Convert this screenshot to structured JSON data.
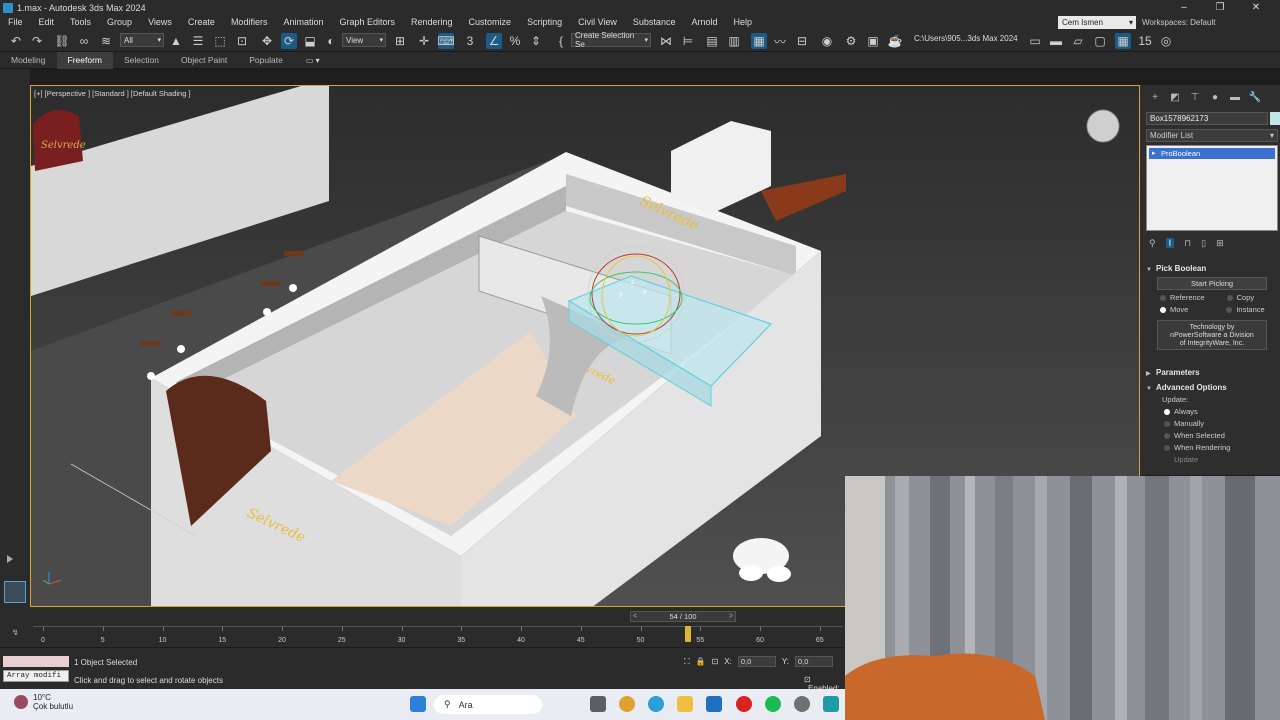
{
  "app": {
    "title": "1.max - Autodesk 3ds Max 2024"
  },
  "window_buttons": [
    "–",
    "❐",
    "✕"
  ],
  "menu": [
    "File",
    "Edit",
    "Tools",
    "Group",
    "Views",
    "Create",
    "Modifiers",
    "Animation",
    "Graph Editors",
    "Rendering",
    "Customize",
    "Scripting",
    "Civil View",
    "Substance",
    "Arnold",
    "Help"
  ],
  "user": {
    "name": "Cem Ismen",
    "workspaces_label": "Workspaces:",
    "workspace_value": "Default"
  },
  "toolbar": {
    "filter_value": "All",
    "view_value": "View",
    "selection_set_value": "Create Selection Se",
    "project_path": "C:\\Users\\905...3ds Max 2024",
    "snap_count": "3",
    "frame_number": "15"
  },
  "ribbon": {
    "tabs": [
      "Modeling",
      "Freeform",
      "Selection",
      "Object Paint",
      "Populate"
    ],
    "active_tab": "Freeform"
  },
  "viewport": {
    "label": "[+] [Perspective ] [Standard ] [Default Shading ]",
    "sign_text": "Selvrede",
    "gizmo": {
      "x": "x",
      "y": "y",
      "z": "z"
    }
  },
  "command_panel": {
    "object_name": "Box1578962173",
    "object_color": "#bfe6ea",
    "modifier_list_label": "Modifier List",
    "stack_item": "ProBoolean",
    "pick_boolean": {
      "title": "Pick Boolean",
      "start_button": "Start Picking",
      "options": [
        {
          "label": "Reference",
          "on": false
        },
        {
          "label": "Copy",
          "on": false
        },
        {
          "label": "Move",
          "on": true
        },
        {
          "label": "Instance",
          "on": false
        }
      ],
      "tech_note": [
        "Technology by",
        "nPowerSoftware a Division",
        "of IntegrityWare, Inc."
      ]
    },
    "parameters_title": "Parameters",
    "advanced_title": "Advanced Options",
    "update_label": "Update:",
    "update_options": [
      {
        "label": "Always",
        "on": true
      },
      {
        "label": "Manually",
        "on": false
      },
      {
        "label": "When Selected",
        "on": false
      },
      {
        "label": "When Rendering",
        "on": false
      }
    ],
    "update_button": "Update"
  },
  "timeline": {
    "frame_readout": "54 / 100",
    "current_frame": 54,
    "ticks": [
      0,
      5,
      10,
      15,
      20,
      25,
      30,
      35,
      40,
      45,
      50,
      55,
      60,
      65
    ]
  },
  "status": {
    "array_label": "Array modifi",
    "selection_text": "1 Object Selected",
    "prompt_text": "Click and drag to select and rotate objects",
    "x_label": "X:",
    "x_value": "0,0",
    "y_label": "Y:",
    "y_value": "0,0",
    "enabled_label": "Enabled:"
  },
  "taskbar": {
    "temperature": "10°C",
    "weather": "Çok bulutlu",
    "search_text": "Ara"
  }
}
